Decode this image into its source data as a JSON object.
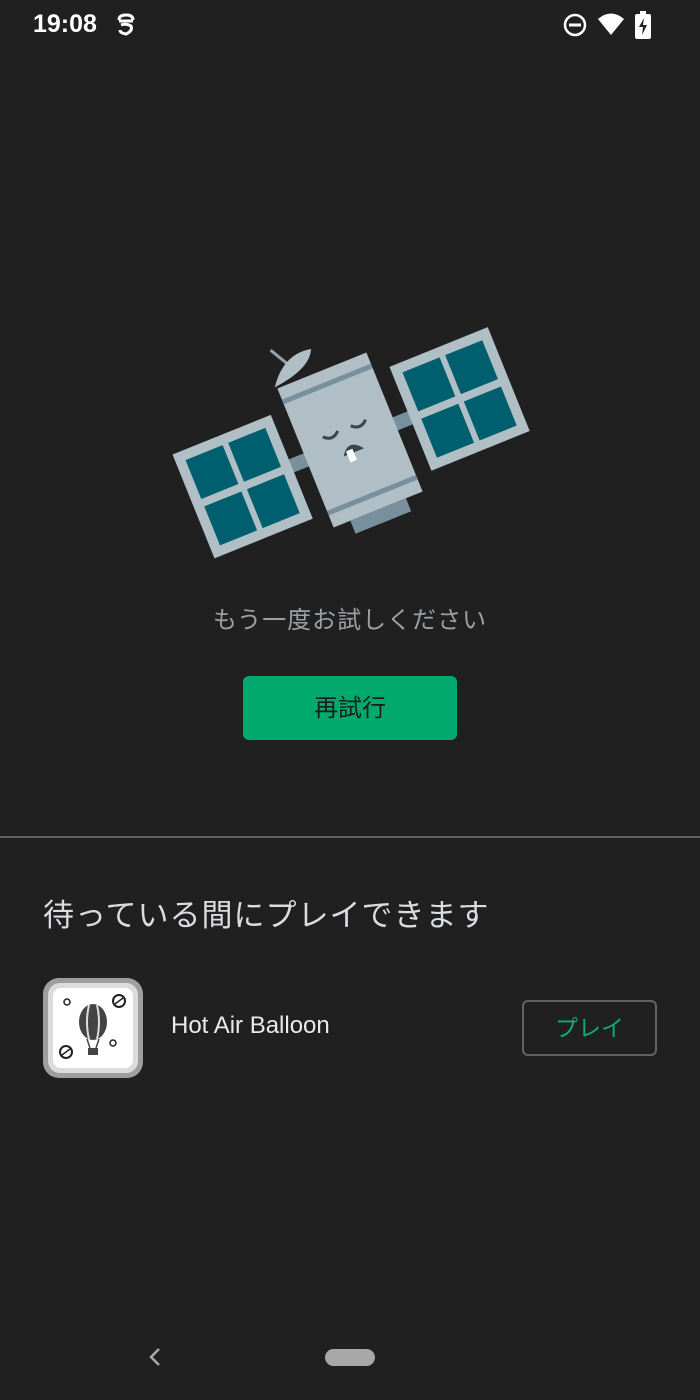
{
  "status_bar": {
    "time": "19:08",
    "icons": [
      "app-notification-icon",
      "do-not-disturb-icon",
      "wifi-icon",
      "battery-charging-icon"
    ]
  },
  "illustration": {
    "icon": "sleeping-satellite-illustration"
  },
  "error": {
    "message": "もう一度お試しください",
    "retry_label": "再試行"
  },
  "games_section": {
    "heading": "待っている間にプレイできます",
    "games": [
      {
        "title": "Hot Air Balloon",
        "play_label": "プレイ",
        "icon": "hot-air-balloon-icon"
      }
    ]
  },
  "nav_bar": {
    "back_icon": "back-chevron-icon",
    "home_icon": "home-pill"
  },
  "colors": {
    "background": "#202020",
    "accent": "#01a96e",
    "play_text": "#0fa97a",
    "panel": "#005f6e",
    "satellite_body": "#b0bec5"
  }
}
